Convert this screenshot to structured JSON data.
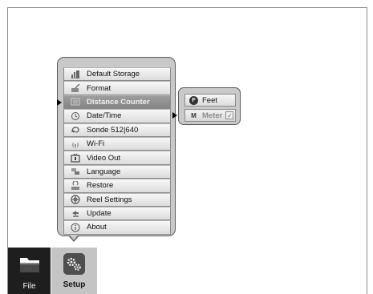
{
  "menu": {
    "items": [
      {
        "label": "Default Storage",
        "icon": "storage-icon"
      },
      {
        "label": "Format",
        "icon": "format-icon"
      },
      {
        "label": "Distance Counter",
        "icon": "distance-counter-icon",
        "selected": true
      },
      {
        "label": "Date/Time",
        "icon": "clock-icon"
      },
      {
        "label": "Sonde 512|640",
        "icon": "sonde-icon"
      },
      {
        "label": "Wi-Fi",
        "icon": "wifi-icon"
      },
      {
        "label": "Video Out",
        "icon": "video-out-icon"
      },
      {
        "label": "Language",
        "icon": "language-icon"
      },
      {
        "label": "Restore",
        "icon": "restore-icon"
      },
      {
        "label": "Reel Settings",
        "icon": "reel-icon"
      },
      {
        "label": "Update",
        "icon": "update-icon"
      },
      {
        "label": "About",
        "icon": "info-icon"
      }
    ]
  },
  "submenu": {
    "feet": {
      "letter": "F",
      "label": "Feet"
    },
    "meter": {
      "letter": "M",
      "label": "Meter",
      "check": "✓"
    }
  },
  "tabs": {
    "file": {
      "label": "File"
    },
    "setup": {
      "label": "Setup"
    }
  },
  "colors": {
    "selected_bg": "#8f8f8f",
    "panel_bg": "#c9c9c9",
    "file_tab_bg": "#1e1e1e",
    "setup_tab_bg": "#c4c4c4"
  }
}
